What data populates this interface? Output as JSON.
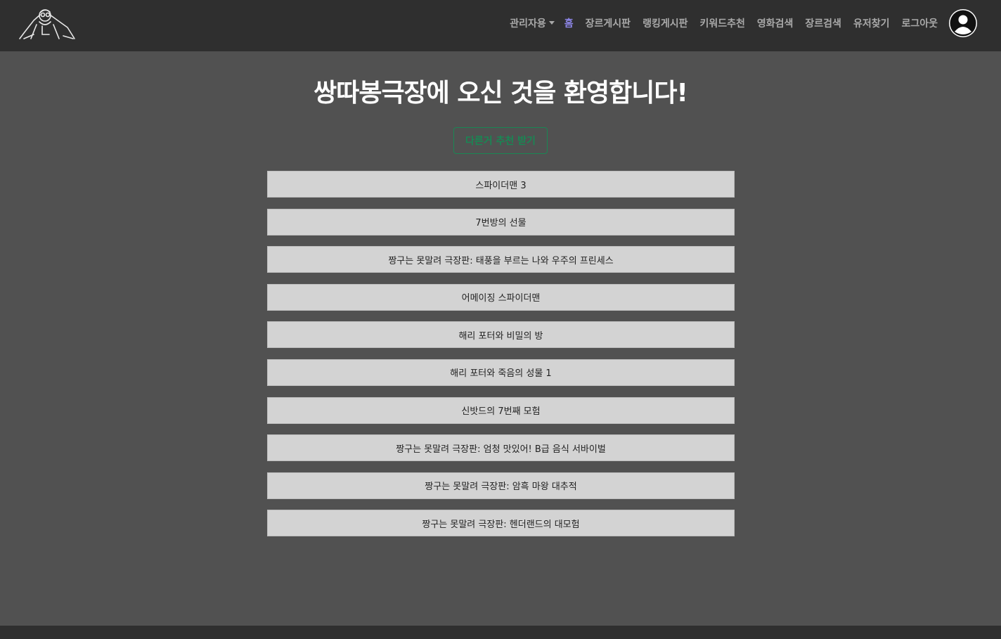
{
  "nav": {
    "links": [
      {
        "label": "관리자용",
        "dropdown": true
      },
      {
        "label": "홈",
        "active": true
      },
      {
        "label": "장르게시판"
      },
      {
        "label": "랭킹게시판"
      },
      {
        "label": "키워드추천"
      },
      {
        "label": "영화검색"
      },
      {
        "label": "장르검색"
      },
      {
        "label": "유저찾기"
      },
      {
        "label": "로그아웃"
      }
    ],
    "logo_icon": "person-doodle-logo-icon",
    "avatar_icon": "user-avatar-icon"
  },
  "main": {
    "headline": "쌍따봉극장에 오신 것을 환영합니다!",
    "recommend_button": "다른거 추천 받기",
    "movies": [
      "스파이더맨 3",
      "7번방의 선물",
      "짱구는 못말려 극장판: 태풍을 부르는 나와 우주의 프린세스",
      "어메이징 스파이더맨",
      "해리 포터와 비밀의 방",
      "해리 포터와 죽음의 성물 1",
      "신밧드의 7번째 모험",
      "짱구는 못말려 극장판: 엄청 맛있어! B급 음식 서바이벌",
      "짱구는 못말려 극장판: 암흑 마왕 대추적",
      "짱구는 못말려 극장판: 헨더랜드의 대모험"
    ]
  },
  "colors": {
    "nav_bg": "#2f2f2f",
    "page_bg": "#515151",
    "active_link": "#8d86e8",
    "success": "#198754",
    "item_bg": "#d3d3d3"
  }
}
